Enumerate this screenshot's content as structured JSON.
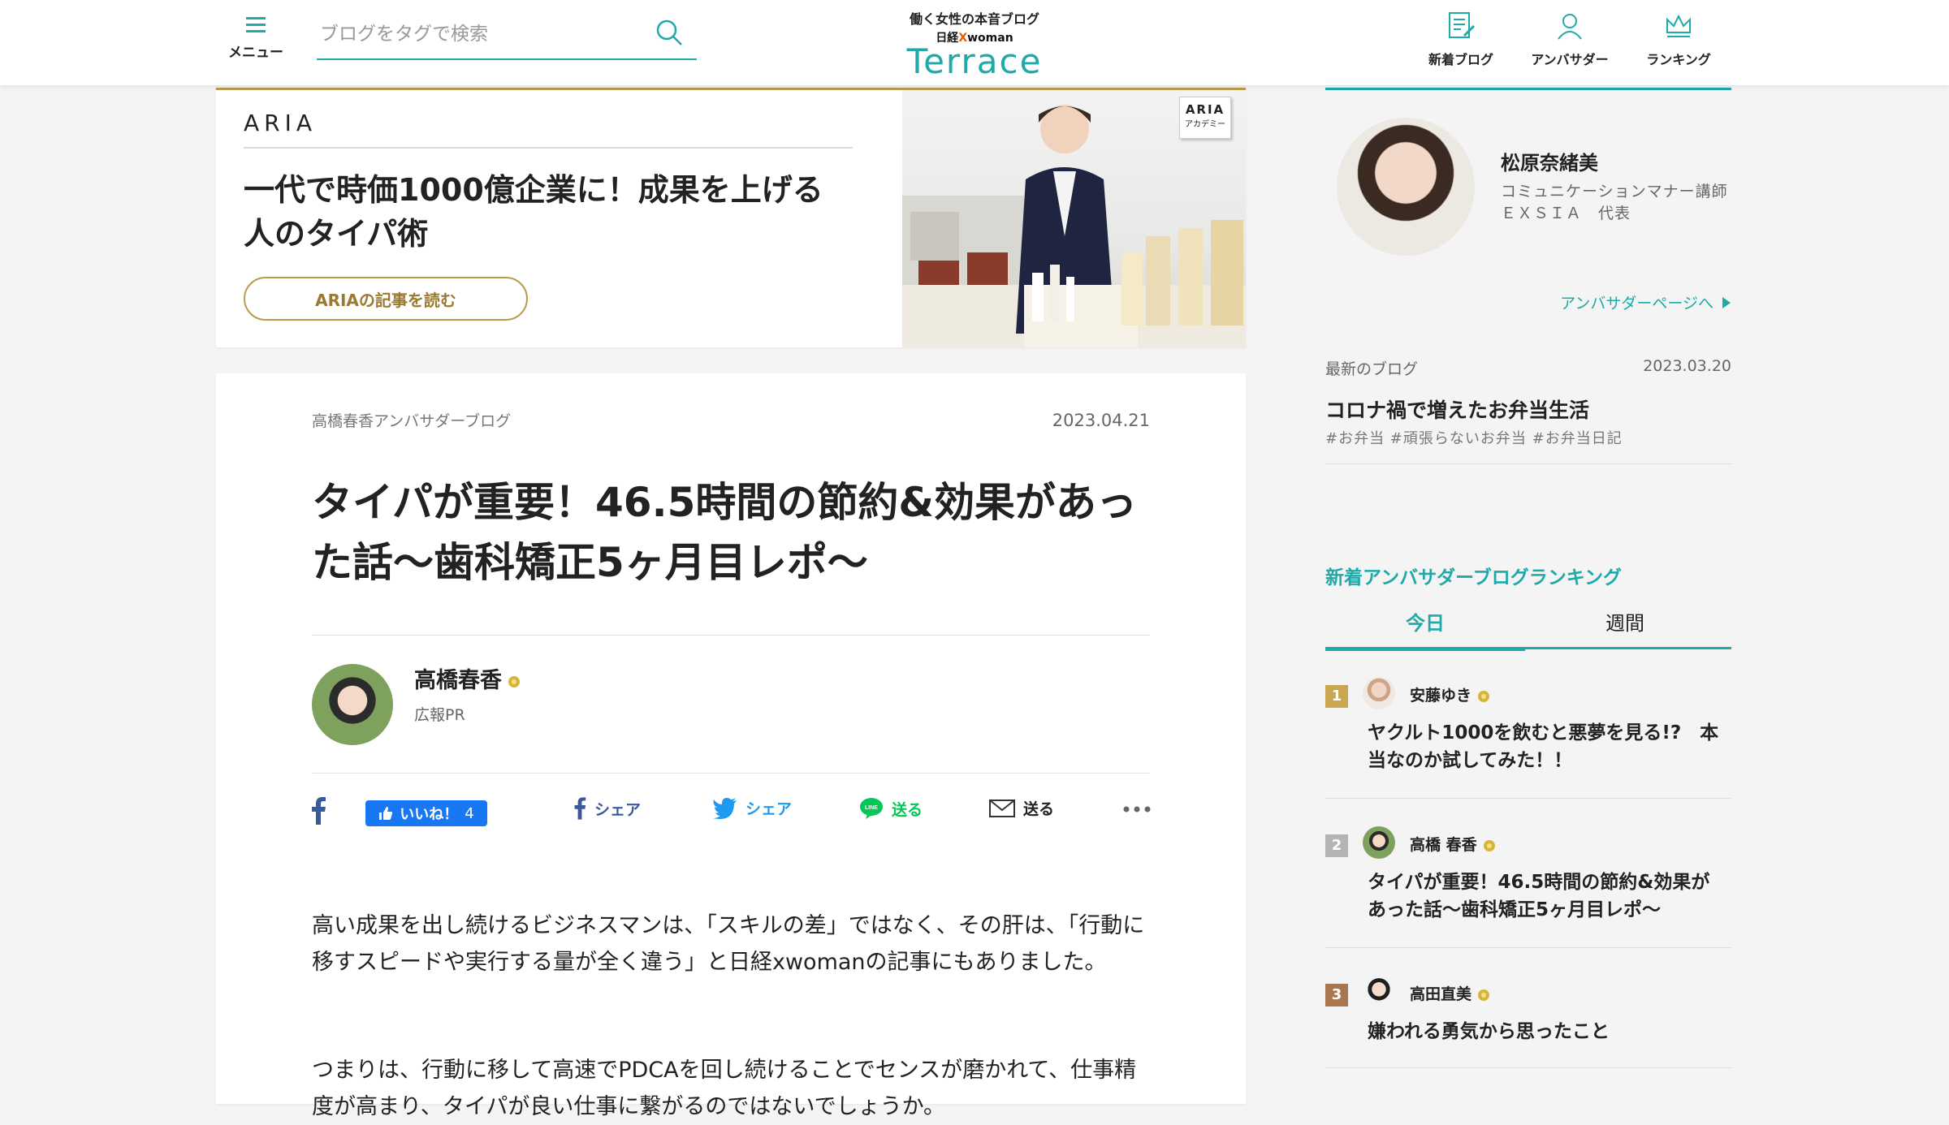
{
  "header": {
    "menu_label": "メニュー",
    "search_placeholder": "ブログをタグで検索",
    "logo": {
      "tagline": "働く女性の本音ブログ",
      "brand_left": "日経",
      "brand_x": "X",
      "brand_right": "woman",
      "wordmark": "Terrace"
    },
    "nav": [
      {
        "label": "新着ブログ",
        "icon": "new-blog-icon"
      },
      {
        "label": "アンバサダー",
        "icon": "ambassador-icon"
      },
      {
        "label": "ランキング",
        "icon": "ranking-icon"
      }
    ]
  },
  "banner": {
    "brand": "ARIA",
    "headline": "一代で時価1000億企業に！成果を上げる人のタイパ術",
    "cta_label": "ARIAの記事を読む",
    "badge_brand": "ARIA",
    "badge_sub": "アカデミー"
  },
  "article": {
    "category": "高橋春香アンバサダーブログ",
    "date": "2023.04.21",
    "title": "タイパが重要！46.5時間の節約&効果があった話〜歯科矯正5ヶ月目レポ〜",
    "author": {
      "name": "高橋春香",
      "role": "広報PR"
    },
    "share": {
      "like_label": "いいね！",
      "like_count": "4",
      "facebook_share": "シェア",
      "twitter_share": "シェア",
      "line_send": "送る",
      "mail_send": "送る"
    },
    "paragraphs": [
      "高い成果を出し続けるビジネスマンは、「スキルの差」ではなく、その肝は、「行動に移すスピードや実行する量が全く違う」と日経xwomanの記事にもありました。",
      "つまりは、行動に移して高速でPDCAを回し続けることでセンスが磨かれて、仕事精度が高まり、タイパが良い仕事に繋がるのではないでしょうか。"
    ]
  },
  "sidebar": {
    "ambassador": {
      "name": "松原奈緒美",
      "desc_line1": "コミュニケーションマナー講師",
      "desc_line2": "ＥＸＳＩＡ　代表",
      "link_label": "アンバサダーページへ"
    },
    "latest": {
      "label": "最新のブログ",
      "date": "2023.03.20",
      "title": "コロナ禍で増えたお弁当生活",
      "tags": "#お弁当  #頑張らないお弁当  #お弁当日記"
    },
    "ranking": {
      "title": "新着アンバサダーブログランキング",
      "tabs": [
        "今日",
        "週間"
      ],
      "items": [
        {
          "rank": "1",
          "name": "安藤ゆき",
          "title": "ヤクルト1000を飲むと悪夢を見る!?　本当なのか試してみた！！",
          "color": "#c9a650"
        },
        {
          "rank": "2",
          "name": "高橋 春香",
          "title": "タイパが重要！46.5時間の節約&効果があった話〜歯科矯正5ヶ月目レポ〜",
          "color": "#b3b3b3"
        },
        {
          "rank": "3",
          "name": "高田直美",
          "title": "嫌われる勇気から思ったこと",
          "color": "#a9774f"
        }
      ]
    }
  },
  "colors": {
    "accent": "#1fa9a9",
    "gold": "#b89a4a",
    "facebook": "#1877f2",
    "twitter": "#1d9bf0",
    "line": "#06c755"
  }
}
